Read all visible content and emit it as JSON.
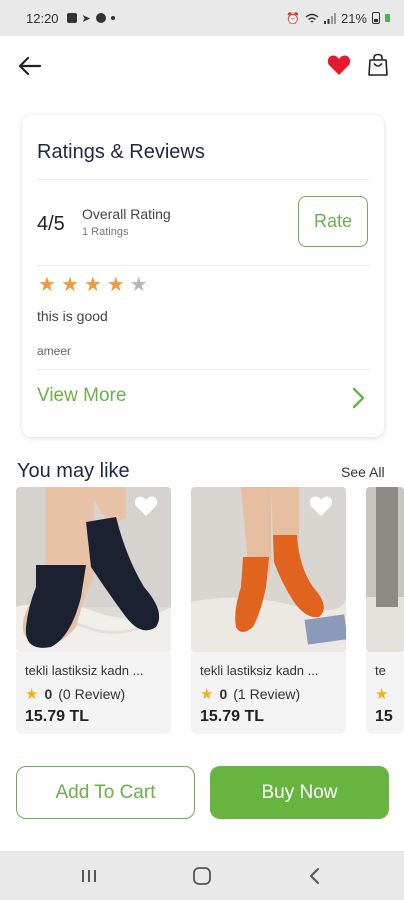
{
  "status_bar": {
    "time": "12:20",
    "battery": "21%"
  },
  "ratings": {
    "title": "Ratings & Reviews",
    "score": "4/5",
    "overall_label": "Overall Rating",
    "count_label": "1 Ratings",
    "rate_button": "Rate",
    "stars_filled": 4,
    "stars_total": 5,
    "review_text": "this is good",
    "reviewer": "ameer",
    "view_more": "View More"
  },
  "you_may_like": {
    "title": "You may like",
    "see_all": "See All",
    "products": [
      {
        "name": "tekli lastiksiz kadn ...",
        "rating": "0",
        "reviews": "(0 Review)",
        "price": "15.79 TL"
      },
      {
        "name": "tekli lastiksiz kadn ...",
        "rating": "0",
        "reviews": "(1 Review)",
        "price": "15.79 TL"
      },
      {
        "name": "te",
        "rating": "",
        "reviews": "",
        "price": "15"
      }
    ]
  },
  "actions": {
    "add_to_cart": "Add To Cart",
    "buy_now": "Buy Now"
  },
  "colors": {
    "accent": "#6ab04c",
    "heart": "#e8192c",
    "star": "#f29a3b",
    "title": "#1e2a44"
  }
}
